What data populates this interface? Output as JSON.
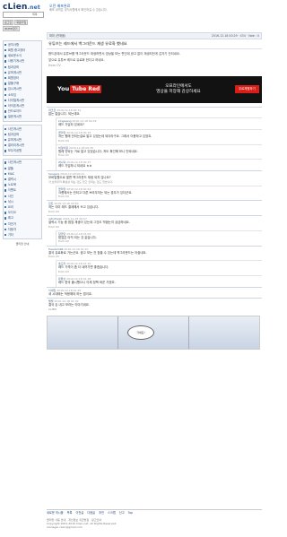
{
  "header": {
    "logo_main": "cLien",
    "logo_suffix": ".net",
    "sort_label": "제목",
    "login_buttons": [
      "로그인",
      "회원가입",
      "ID/PW찾기"
    ]
  },
  "notice": {
    "title": "오전 배포완료",
    "subtitle": "배포 내역은 공지사항에서 확인하실 수 있습니다."
  },
  "sidebar": {
    "group1": [
      "공지사항",
      "회원 중고장터",
      "새로운소식",
      "사용기게시판",
      "팁과강좌",
      "유머게시판",
      "회원장터",
      "알뜰구매",
      "임시게시판",
      "소모임",
      "디지털게시판",
      "아이폰게시판",
      "안드로이드",
      "질문게시판"
    ],
    "group2": [
      "사진게시판",
      "팁과강좌",
      "유머게시판",
      "갤러리게시판",
      "모두의공원"
    ],
    "group3": [
      "사진게시판",
      "알뜰",
      "MAC",
      "갤럭시",
      "노트북",
      "이벤트",
      "사진",
      "낚시",
      "요리",
      "오디오",
      "레고",
      "자전거",
      "자동차",
      "기타"
    ],
    "footer_link": "클리앙 안내"
  },
  "article": {
    "meta_left": "짜파 (찬깨불)",
    "meta_right": "2016-12-18 00:29 · 434 · Vote : 0",
    "title": "유튜브는 레드에서 백그라운드 재생 유료화 했네요",
    "body": [
      "핸드폰에서 유튜브를 백그라운드 재생하면서 영상을 보는 편인데 광고 없이 재생되던게 갑자기 안되네요.",
      "앞으로 유튜브 레드로 유료화 한다고 하네요."
    ],
    "from": "from CV"
  },
  "ad": {
    "brand_you": "You",
    "brand_tube": "Tube Red",
    "copy_line1": "오프라인에서도",
    "copy_line2": "영상을 저장해 감상하세요",
    "cta": "무료체험하기"
  },
  "comments": [
    {
      "nick": "마크르",
      "time": "2016-12-18 00:31",
      "text": "없는 없습니다. 되는데요.",
      "from": "",
      "reply": false
    },
    {
      "nick": "kingwang",
      "time": "2016-12-18 00:32",
      "text": "레드 가입되 있네요?",
      "from": "",
      "reply": true
    },
    {
      "nick": "클리앙",
      "time": "2016-12-18 00:33",
      "text": "저는 원래 안되는걸로 알고 있었는데 되더라구요. 그래서 이용하고 있었죠.",
      "from": "from CV",
      "reply": true
    },
    {
      "nick": "바닷바람",
      "time": "2016-12-18 00:35",
      "text": "원래 안되는 거로 알고 있었습니다. 저도 확인해 보니 안되네요.",
      "from": "from CV",
      "reply": true
    },
    {
      "nick": "써니덕",
      "time": "2016-12-18 00:37",
      "text": "레드 가입하니 되네요 ㅎㅎ",
      "from": "",
      "reply": true
    },
    {
      "nick": "hangul1",
      "time": "2016-12-18 00:41",
      "text": "모바일웹으로 열면 백그라운드 재생 되지 않나요?",
      "from": "각 브라우저 특성상 되는 것도 있고 안되는 것도 있습니다.",
      "reply": false
    },
    {
      "nick": "클리앙",
      "time": "2016-12-18 00:44",
      "text": "크롬에서는 안되고 다른 브라우저는 되는 경우가 있더군요.",
      "from": "from CV",
      "reply": true
    },
    {
      "nick": "민트",
      "time": "2016-12-18 00:50",
      "text": "저는 이미 레드 결제해서 쓰고 있습니다.",
      "from": "from CV",
      "reply": false
    },
    {
      "nick": "retrofreak",
      "time": "2016-12-18 00:57",
      "text": "갤럭시 기능 중 팝업 재생이 있는데 그것도 막혔는지 궁금하네요.",
      "from": "from CV",
      "reply": false
    },
    {
      "nick": "잠깐만",
      "time": "2016-12-18 01:02",
      "text": "팝업은 아직 되는 것 같습니다.",
      "from": "from CV",
      "reply": true
    },
    {
      "nick": "freedom96",
      "time": "2016-12-18 01:10",
      "text": "결국 유료화로 가는군요. 광고 보는 건 참을 수 있는데 백그라운드는 아쉽네요.",
      "from": "from CV",
      "reply": false
    },
    {
      "nick": "호도리",
      "time": "2016-12-18 01:15",
      "text": "레드 가격이 좀 더 내려가면 좋겠습니다.",
      "from": "from CV",
      "reply": true
    },
    {
      "nick": "유튜브",
      "time": "2016-12-18 01:18",
      "text": "레드 한국 출시했으니 이제 정책 바꾼 거겠죠.",
      "from": "",
      "reply": true
    },
    {
      "nick": "닉네임",
      "time": "2016-12-18 01:25",
      "text": "새 시대에는 적응해야 하는 법이죠.",
      "from": "",
      "reply": false
    },
    {
      "nick": "별빛",
      "time": "2016-12-18 01:32",
      "text": "결국 돈 내고 보라는 이야기네요.",
      "from": "CLIEN",
      "reply": false
    }
  ],
  "comic_ad": {
    "bubble": "가세요!"
  },
  "toolbar": [
    "새로운 게시물",
    "목록",
    "이전글",
    "다음글",
    "추천",
    "스크랩",
    "신고",
    "Top"
  ],
  "footer": {
    "line1": "클리앙 사용 안내 · 개인정보 취급방침 · 광고안내",
    "line2": "Copyright 2001-2016 Clien.net. All Rights Reserved.",
    "line3": "manager.clien@gmail.com"
  }
}
